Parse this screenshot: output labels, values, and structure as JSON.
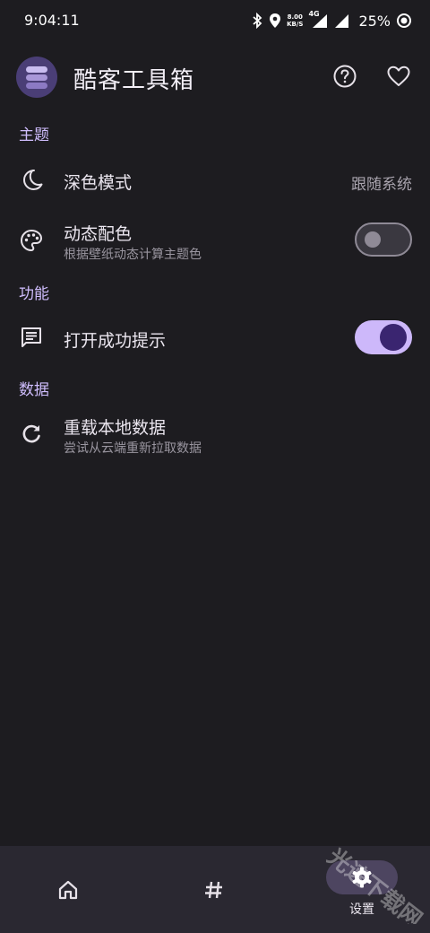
{
  "status_bar": {
    "time": "9:04:11",
    "net_speed_value": "8.00",
    "net_speed_unit": "KB/S",
    "network": "4G",
    "battery": "25%"
  },
  "header": {
    "title": "酷客工具箱",
    "help_icon": "help-circle-icon",
    "favorite_icon": "heart-outline-icon"
  },
  "sections": {
    "theme": {
      "title": "主题",
      "dark_mode": {
        "icon": "moon-icon",
        "title": "深色模式",
        "value": "跟随系统"
      },
      "dynamic_color": {
        "icon": "palette-icon",
        "title": "动态配色",
        "subtitle": "根据壁纸动态计算主题色",
        "enabled": false
      }
    },
    "features": {
      "title": "功能",
      "open_success_tip": {
        "icon": "message-icon",
        "title": "打开成功提示",
        "enabled": true
      }
    },
    "data": {
      "title": "数据",
      "reload": {
        "icon": "refresh-icon",
        "title": "重载本地数据",
        "subtitle": "尝试从云端重新拉取数据"
      }
    }
  },
  "bottom_nav": {
    "items": [
      {
        "icon": "home-icon",
        "label": ""
      },
      {
        "icon": "hash-icon",
        "label": ""
      },
      {
        "icon": "settings-gear-icon",
        "label": "设置",
        "selected": true
      }
    ]
  },
  "watermark": {
    "text": "光速下载网"
  },
  "colors": {
    "background": "#1d1c20",
    "accent": "#cfbdfd",
    "switch_on_track": "#cdb8fa",
    "switch_on_knob": "#3a2570",
    "nav_background": "#2a2831",
    "nav_selected_pill": "#4d4560"
  }
}
